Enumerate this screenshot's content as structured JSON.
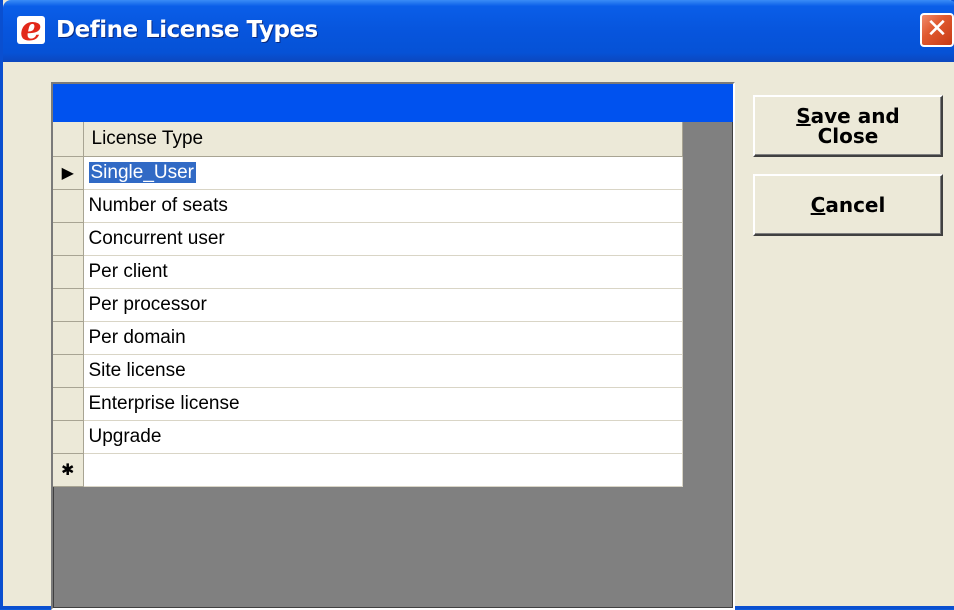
{
  "window": {
    "title": "Define License Types",
    "app_icon_glyph": "e",
    "close_glyph": "✕"
  },
  "grid": {
    "column_header": "License Type",
    "rows": [
      "Single_User",
      "Number of seats",
      "Concurrent user",
      "Per client",
      "Per processor",
      "Per domain",
      "Site license",
      "Enterprise license",
      "Upgrade"
    ],
    "current_row_marker": "▶",
    "new_row_marker": "✱",
    "selected_row_index": 0
  },
  "buttons": {
    "save_close": {
      "mnemonic": "S",
      "line1_rest": "ave and",
      "line2": "Close"
    },
    "cancel": {
      "mnemonic": "C",
      "rest": "ancel"
    }
  },
  "colors": {
    "titlebar": "#0755dd",
    "caption_bar": "#0052ef",
    "selection": "#316ac5",
    "close_button": "#e05a30",
    "dialog_face": "#ece9d8",
    "grid_background": "#808080"
  }
}
